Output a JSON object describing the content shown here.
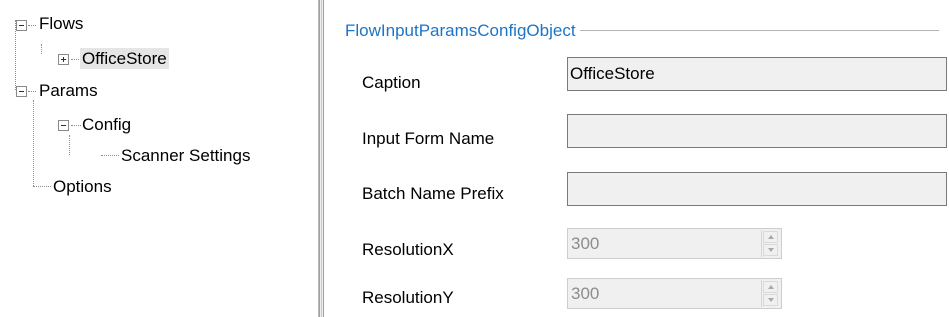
{
  "tree": {
    "flows": {
      "label": "Flows",
      "expander": "minus",
      "children": [
        {
          "label": "OfficeStore",
          "expander": "plus",
          "selected": true
        }
      ]
    },
    "params": {
      "label": "Params",
      "expander": "minus",
      "children": [
        {
          "label": "Config",
          "expander": "minus",
          "children": [
            {
              "label": "Scanner Settings"
            }
          ]
        }
      ]
    },
    "options": {
      "label": "Options"
    }
  },
  "panel": {
    "group_title": "FlowInputParamsConfigObject",
    "caption": {
      "label": "Caption",
      "value": "OfficeStore"
    },
    "input_form_name": {
      "label": "Input Form Name",
      "value": ""
    },
    "batch_name_prefix": {
      "label": "Batch Name Prefix",
      "value": ""
    },
    "resolution_x": {
      "label": "ResolutionX",
      "value": "300",
      "enabled": false
    },
    "resolution_y": {
      "label": "ResolutionY",
      "value": "300",
      "enabled": false
    }
  },
  "colors": {
    "group_title": "#1c74c8",
    "field_background": "#f0f0f0",
    "selected_node": "#e5e5e5"
  },
  "icons": {
    "expand": "plus-box-icon",
    "collapse": "minus-box-icon",
    "spin_up": "chevron-up-icon",
    "spin_down": "chevron-down-icon"
  }
}
